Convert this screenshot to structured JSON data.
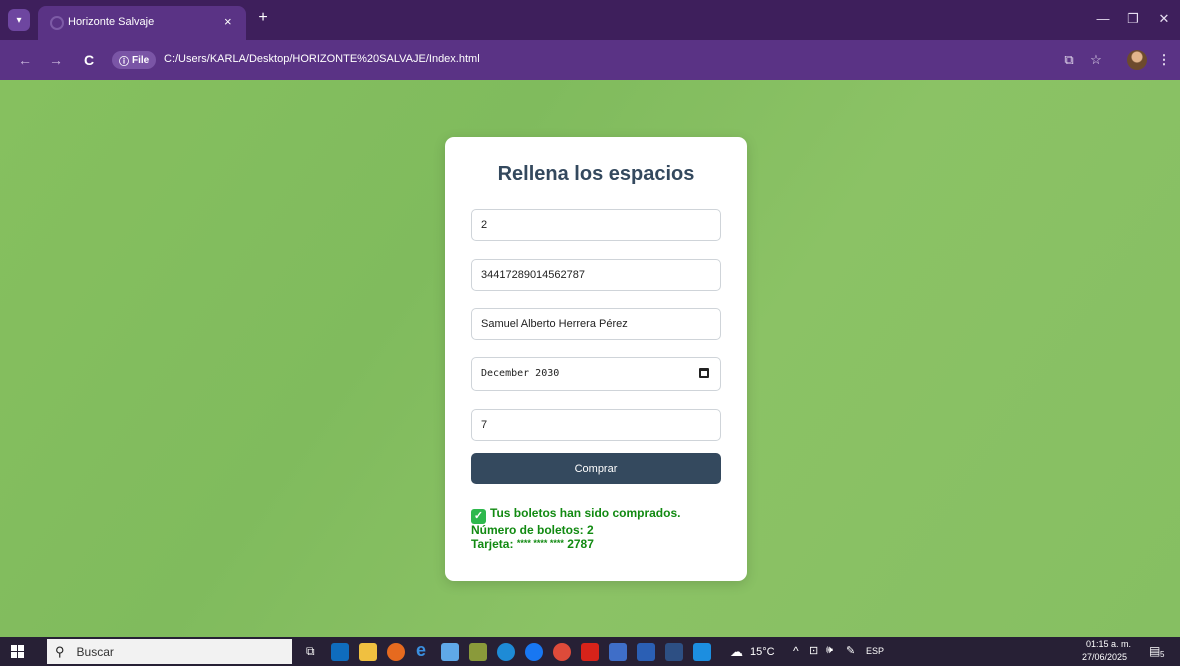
{
  "browser": {
    "tab_title": "Horizonte Salvaje",
    "tab_close": "×",
    "new_tab": "+",
    "site_chip": "File",
    "url": "C:/Users/KARLA/Desktop/HORIZONTE%20SALVAJE/Index.html",
    "icons": [
      "tab-menu-icon",
      "back-icon",
      "forward-icon",
      "reload-icon",
      "info-icon",
      "translate-icon",
      "star-icon",
      "profile-avatar",
      "more-menu-icon",
      "minimize-icon",
      "restore-icon",
      "close-icon"
    ]
  },
  "form": {
    "title": "Rellena los espacios",
    "fields": {
      "boletos": "2",
      "tarjeta": "34417289014562787",
      "nombre": "Samuel Alberto Herrera Pérez",
      "vencimiento": "December 2030",
      "cvv": "7"
    },
    "button_label": "Comprar",
    "result": {
      "line1": "Tus boletos han sido comprados.",
      "line2": "Número de boletos: 2",
      "line3_label": "Tarjeta:",
      "line3_mask": "**** **** ****",
      "line3_last4": "2787"
    }
  },
  "taskbar": {
    "search_placeholder": "Buscar",
    "weather": "15°C",
    "language": "ESP",
    "time": "01:15 a. m.",
    "date": "27/06/2025",
    "notifications": "5",
    "apps": [
      "task-view",
      "outlook",
      "file-explorer",
      "firefox",
      "internet-explorer",
      "paint-app",
      "calculator",
      "edge",
      "facebook",
      "chrome",
      "acrobat",
      "photos-app",
      "word",
      "app-icon",
      "vscode"
    ]
  },
  "colors": {
    "tab_strip": "#3e1f5c",
    "toolbar": "#5a3385",
    "page_background": "#85bf61",
    "card_title": "#34495e",
    "button": "#34495e",
    "success_text": "#118a11"
  }
}
